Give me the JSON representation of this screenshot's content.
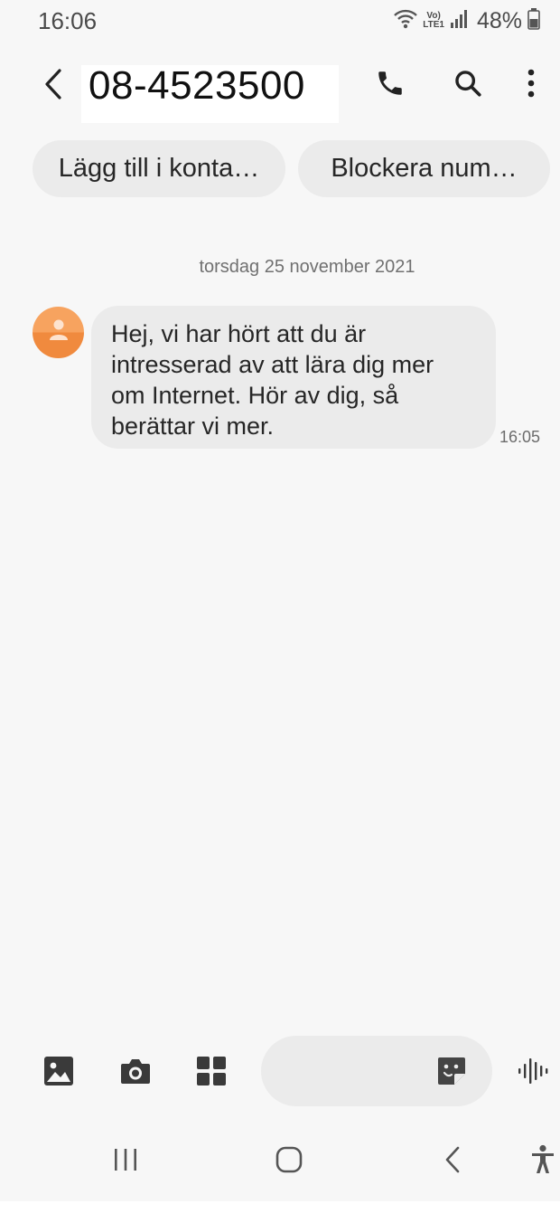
{
  "status_bar": {
    "time": "16:06",
    "volte_top": "Vo)",
    "volte_bottom": "LTE1",
    "battery_percent": "48%",
    "icons": [
      "wifi-icon",
      "volte-icon",
      "signal-icon",
      "battery-icon"
    ]
  },
  "header": {
    "title": "08-4523500",
    "icons": [
      "back-icon",
      "phone-icon",
      "search-icon",
      "more-icon"
    ]
  },
  "chips": {
    "add_contact": "Lägg till i konta…",
    "block_number": "Blockera num…"
  },
  "conversation": {
    "date": "torsdag 25 november 2021",
    "messages": [
      {
        "lines": [
          "Hej, vi har hört att du är",
          "intresserad av att lära dig mer",
          "om Internet. Hör av dig, så",
          "berättar vi mer."
        ],
        "time": "16:05"
      }
    ]
  },
  "composer": {
    "icons": [
      "gallery-icon",
      "camera-icon",
      "apps-icon",
      "sticker-icon",
      "voice-icon"
    ]
  },
  "nav_bar": {
    "icons": [
      "recents-icon",
      "home-icon",
      "nav-back-icon",
      "accessibility-icon"
    ]
  },
  "colors": {
    "background": "#f7f7f7",
    "bubble": "#ebebeb",
    "avatar": "#f39a4f",
    "icon": "#333333"
  }
}
